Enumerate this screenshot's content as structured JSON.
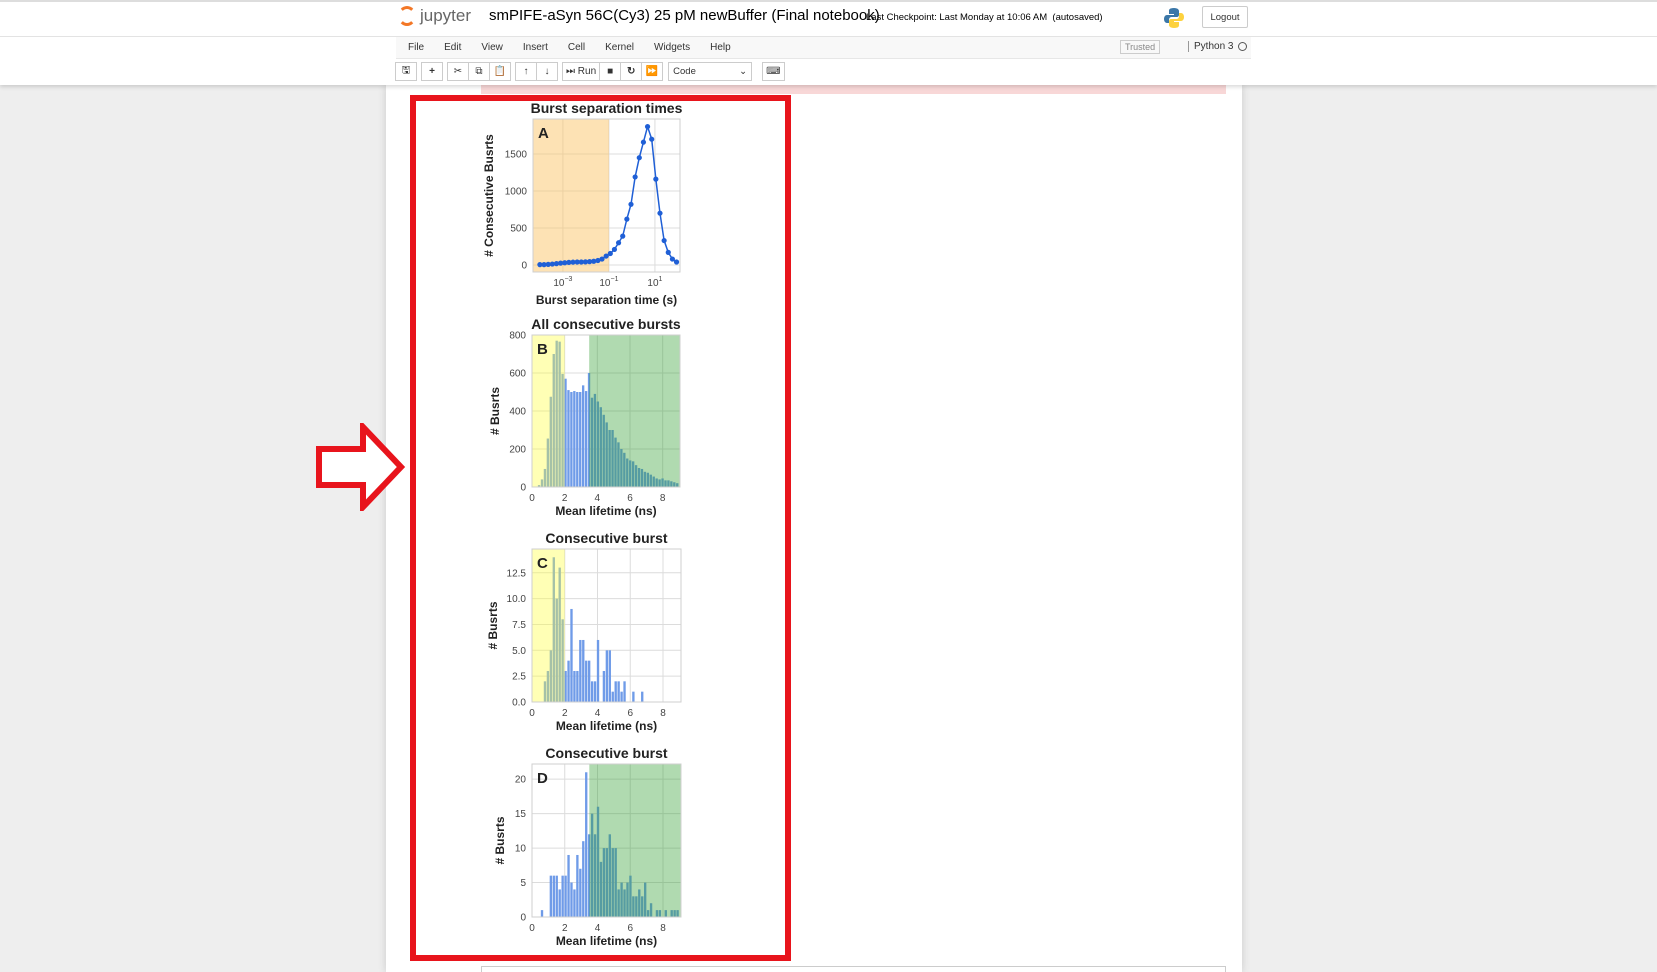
{
  "header": {
    "logo_text": "jupyter",
    "notebook_title": "smPIFE-aSyn 56C(Cy3) 25 pM newBuffer (Final notebook)",
    "checkpoint": "Last Checkpoint: Last Monday at 10:06 AM",
    "autosave": "(autosaved)",
    "logout_label": "Logout",
    "trusted_label": "Trusted",
    "kernel_name": "Python 3"
  },
  "menu": [
    "File",
    "Edit",
    "View",
    "Insert",
    "Cell",
    "Kernel",
    "Widgets",
    "Help"
  ],
  "toolbar": {
    "run_label": "Run",
    "cell_type": "Code"
  },
  "chart_data": [
    {
      "id": "A",
      "type": "line",
      "title": "Burst separation times",
      "xlabel": "Burst separation time (s)",
      "ylabel": "# Consecutive Busrts",
      "panel_label": "A",
      "xscale": "log",
      "xlim_log10": [
        -4.3,
        2.09
      ],
      "ylim": [
        -95,
        1973
      ],
      "xticks_log10": [
        -3,
        -1,
        1
      ],
      "xtick_labels": [
        "10",
        "10",
        "10"
      ],
      "xtick_exponents": [
        "−3",
        "−1",
        "1"
      ],
      "yticks": [
        0,
        500,
        1000,
        1500
      ],
      "ytick_labels": [
        "0",
        "500",
        "1000",
        "1500"
      ],
      "shade": [
        {
          "from_log10": -4.3,
          "to_log10": -1,
          "color": "#fbc56a"
        }
      ],
      "series_color": "#1f5fd6",
      "x_log10": [
        -4.0,
        -3.82,
        -3.64,
        -3.46,
        -3.28,
        -3.1,
        -2.92,
        -2.74,
        -2.56,
        -2.38,
        -2.2,
        -2.02,
        -1.84,
        -1.66,
        -1.48,
        -1.3,
        -1.12,
        -0.94,
        -0.76,
        -0.58,
        -0.4,
        -0.22,
        -0.04,
        0.14,
        0.32,
        0.5,
        0.68,
        0.86,
        1.04,
        1.22,
        1.4,
        1.58,
        1.76,
        1.94
      ],
      "y": [
        5,
        5,
        8,
        12,
        18,
        25,
        30,
        35,
        38,
        40,
        40,
        42,
        45,
        50,
        60,
        80,
        120,
        155,
        210,
        300,
        390,
        620,
        820,
        1190,
        1450,
        1660,
        1870,
        1700,
        1160,
        700,
        330,
        170,
        80,
        40
      ]
    },
    {
      "id": "B",
      "type": "bar",
      "title": "All consecutive bursts",
      "xlabel": "Mean lifetime (ns)",
      "ylabel": "# Busrts",
      "panel_label": "B",
      "xlim": [
        0,
        9.06
      ],
      "ylim": [
        0,
        800
      ],
      "bin_width": 0.18,
      "xticks": [
        0,
        2,
        4,
        6,
        8
      ],
      "xtick_labels": [
        "0",
        "2",
        "4",
        "6",
        "8"
      ],
      "yticks": [
        0,
        200,
        400,
        600,
        800
      ],
      "ytick_labels": [
        "0",
        "200",
        "400",
        "600",
        "800"
      ],
      "shade": [
        {
          "from": 0,
          "to": 2,
          "color": "#ffff3c"
        },
        {
          "from": 3.5,
          "to": 9.06,
          "color": "#2f9e2f"
        }
      ],
      "values": [
        0,
        0,
        10,
        40,
        95,
        255,
        475,
        700,
        770,
        765,
        595,
        570,
        510,
        500,
        505,
        500,
        500,
        535,
        505,
        600,
        470,
        490,
        450,
        420,
        380,
        340,
        300,
        300,
        260,
        235,
        200,
        180,
        150,
        140,
        135,
        115,
        100,
        95,
        80,
        75,
        65,
        55,
        45,
        40,
        45,
        35,
        35,
        30,
        25,
        20
      ]
    },
    {
      "id": "C",
      "type": "bar",
      "title": "Consecutive burst",
      "xlabel": "Mean lifetime (ns)",
      "ylabel": "# Busrts",
      "panel_label": "C",
      "xlim": [
        0,
        9.1
      ],
      "ylim": [
        0,
        14.8
      ],
      "bin_width": 0.18,
      "xticks": [
        0,
        2,
        4,
        6,
        8
      ],
      "xtick_labels": [
        "0",
        "2",
        "4",
        "6",
        "8"
      ],
      "yticks": [
        0,
        2.5,
        5,
        7.5,
        10,
        12.5
      ],
      "ytick_labels": [
        "0.0",
        "2.5",
        "5.0",
        "7.5",
        "10.0",
        "12.5"
      ],
      "shade": [
        {
          "from": 0,
          "to": 2,
          "color": "#ffff3c"
        }
      ],
      "values": [
        0,
        0,
        0,
        0,
        2,
        3,
        5,
        14,
        10,
        13,
        8,
        3,
        4,
        9,
        3,
        3,
        6,
        6,
        4,
        4,
        2,
        2,
        6,
        0,
        3,
        5,
        5,
        1,
        2,
        2,
        1,
        2,
        0,
        0,
        1,
        0,
        0,
        1,
        0,
        0,
        0,
        0,
        0,
        0,
        0,
        0,
        0,
        0,
        0,
        0
      ]
    },
    {
      "id": "D",
      "type": "bar",
      "title": "Consecutive burst",
      "xlabel": "Mean lifetime (ns)",
      "ylabel": "# Busrts",
      "panel_label": "D",
      "xlim": [
        0,
        9.1
      ],
      "ylim": [
        0,
        22.2
      ],
      "bin_width": 0.18,
      "xticks": [
        0,
        2,
        4,
        6,
        8
      ],
      "xtick_labels": [
        "0",
        "2",
        "4",
        "6",
        "8"
      ],
      "yticks": [
        0,
        5,
        10,
        15,
        20
      ],
      "ytick_labels": [
        "0",
        "5",
        "10",
        "15",
        "20"
      ],
      "shade": [
        {
          "from": 3.5,
          "to": 9.1,
          "color": "#2f9e2f"
        }
      ],
      "values": [
        0,
        0,
        0,
        1,
        0,
        0,
        6,
        6,
        6,
        4,
        6,
        6,
        9,
        5,
        4,
        9,
        7,
        11,
        21,
        12,
        15,
        12,
        16,
        8,
        10,
        10,
        12,
        10,
        10,
        4,
        5,
        4,
        5,
        6,
        3,
        3,
        4,
        3,
        5,
        1,
        2,
        0,
        1,
        1,
        0,
        1,
        0,
        1,
        1,
        1
      ]
    }
  ]
}
